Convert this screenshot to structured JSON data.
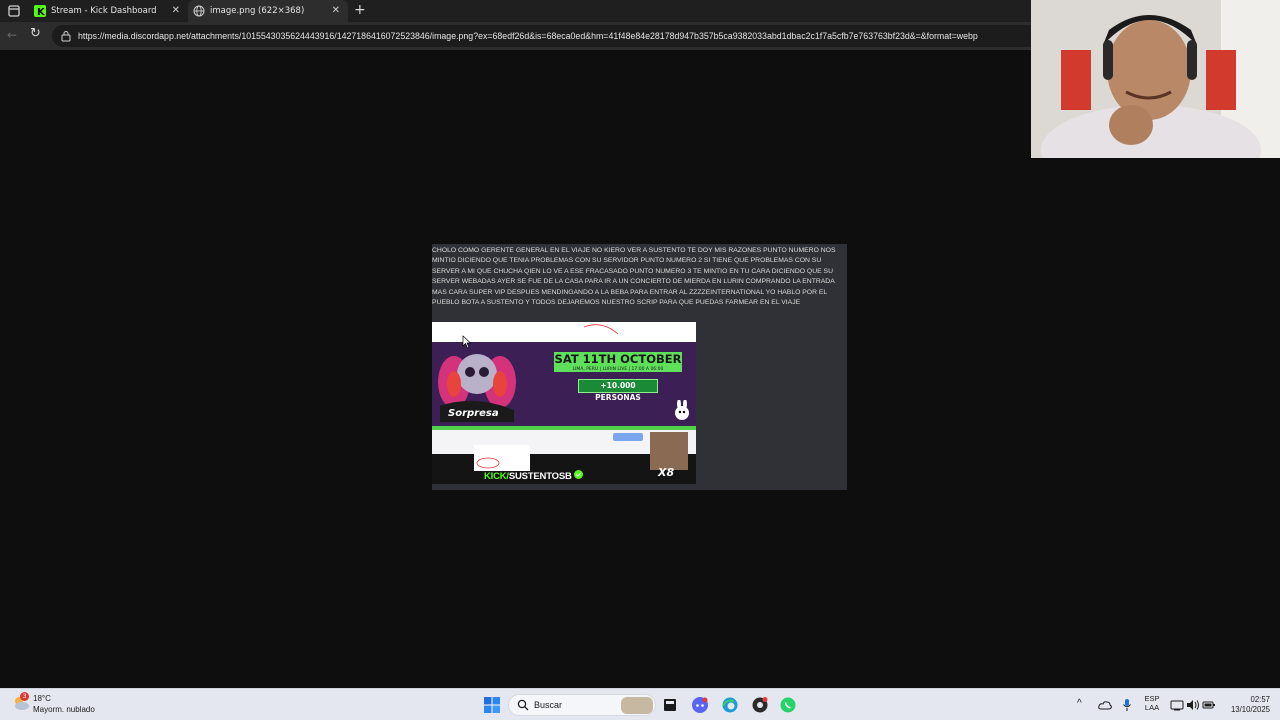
{
  "browser": {
    "tabs": [
      {
        "label": "Stream - Kick Dashboard",
        "icon": "kick-icon"
      },
      {
        "label": "image.png (622×368)",
        "icon": "globe-icon",
        "active": true
      }
    ],
    "url": "https://media.discordapp.net/attachments/1015543035624443916/1427186416072523846/image.png?ex=68edf26d&is=68eca0ed&hm=41f48e84e28178d947b357b5ca9382033abd1dbac2c1f7a5cfb7e763763bf23d&=&format=webp"
  },
  "message": {
    "text": "CHOLO COMO GERENTE GENERAL  EN EL VIAJE NO KIERO VER A SUSTENTO TE DOY MIS RAZONES PUNTO NUMERO NOS MINTIO DICIENDO QUE TENIA PROBLEMAS CON SU SERVIDOR PUNTO NUMERO 2 SI TIENE QUE PROBLEMAS CON SU SERVER A MI QUE CHUCHA QIEN LO VE A ESE FRACASADO PUNTO NUMERO 3 TE MINTIO EN TU CARA DICIENDO QUE SU SERVER WEBADAS AYER SE FUE DE LA CASA PARA IR A UN CONCIERTO DE MIERDA EN LURIN COMPRANDO LA ENTRADA MAS CARA SUPER VIP DESPUES MENDINGANDO A LA BEBA PARA ENTRAR AL ZZZZEINTERNATIONAL YO HABLO POR EL PUEBLO BOTA A SUSTENTO Y TODOS DEJAREMOS NUESTRO SCRIP PARA QUE PUEDAS FARMEAR EN EL VIAJE"
  },
  "embed": {
    "date": "SAT 11TH OCTOBER",
    "date_sub": "LIMA, PERU | LURIN LIVE | 17:00 A 06:00",
    "people": "+10.000 PERSONAS",
    "kick_prefix": "KICK/",
    "kick_channel": "SUSTENTOSB",
    "multiplier": "X8"
  },
  "taskbar": {
    "weather_temp": "18°C",
    "weather_desc": "Mayorm. nublado",
    "weather_badge": "3",
    "search_placeholder": "Buscar",
    "lang_top": "ESP",
    "lang_bottom": "LAA",
    "time": "02:57",
    "date": "13/10/2025"
  },
  "colors": {
    "kick_green": "#53fc18",
    "page_bg": "#0e0e0e",
    "message_bg": "#2f3136"
  }
}
